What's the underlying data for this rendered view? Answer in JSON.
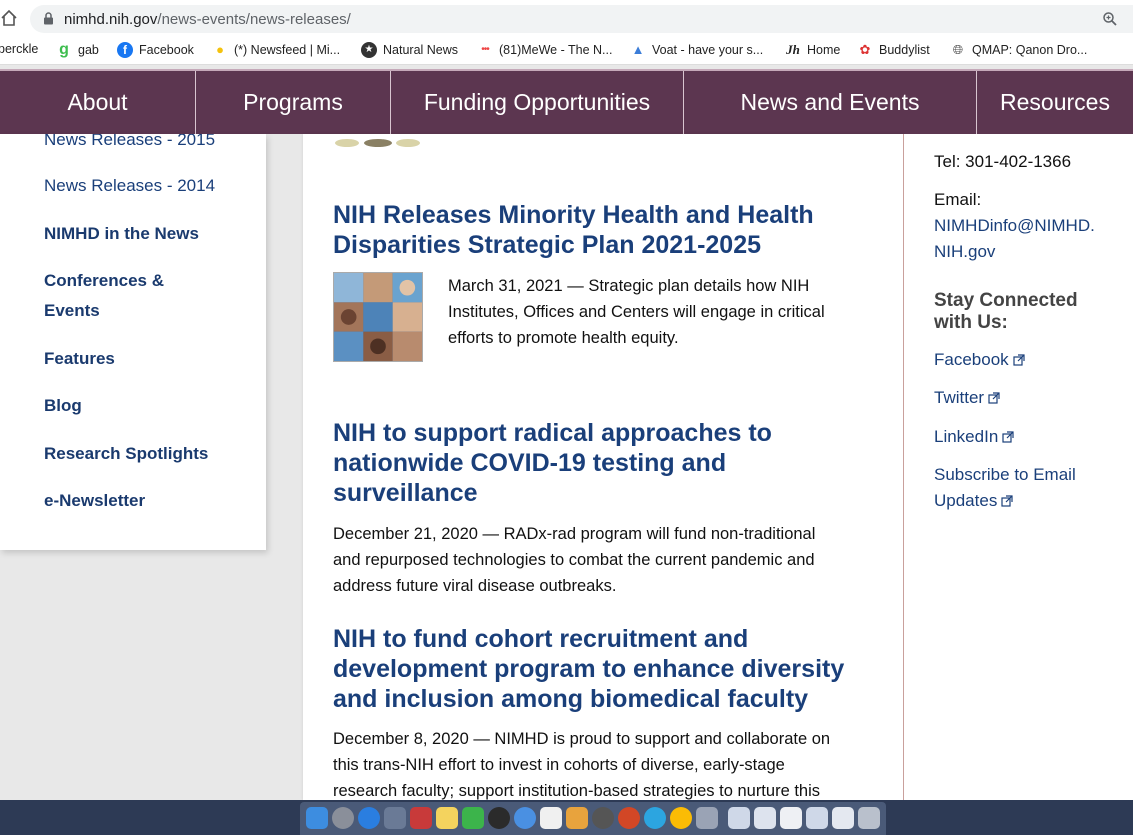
{
  "browser": {
    "url_domain": "nimhd.nih.gov",
    "url_path": "/news-events/news-releases/"
  },
  "bookmarks": [
    {
      "label": "perckle",
      "icon": "partial-bookmark"
    },
    {
      "label": "gab",
      "icon": "gab-icon"
    },
    {
      "label": "Facebook",
      "icon": "facebook-icon"
    },
    {
      "label": "(*) Newsfeed | Mi...",
      "icon": "lightbulb-icon"
    },
    {
      "label": "Natural News",
      "icon": "natural-news-icon"
    },
    {
      "label": "(81)MeWe - The N...",
      "icon": "mewe-icon"
    },
    {
      "label": "Voat - have your s...",
      "icon": "voat-icon"
    },
    {
      "label": "Home",
      "icon": "jh-icon"
    },
    {
      "label": "Buddylist",
      "icon": "buddylist-icon"
    },
    {
      "label": "QMAP: Qanon Dro...",
      "icon": "globe-icon"
    }
  ],
  "nav": {
    "items": [
      "About",
      "Programs",
      "Funding Opportunities",
      "News and Events",
      "Resources"
    ]
  },
  "sidebar": {
    "cut_item": "News Releases - 2015",
    "items": [
      {
        "label": "News Releases - 2014",
        "bold": false
      },
      {
        "label": "NIMHD in the News",
        "bold": true
      },
      {
        "label": "Conferences &",
        "label2": "Events",
        "bold": true
      },
      {
        "label": "Features",
        "bold": true
      },
      {
        "label": "Blog",
        "bold": true
      },
      {
        "label": "Research Spotlights",
        "bold": true
      },
      {
        "label": "e-Newsletter",
        "bold": true
      }
    ]
  },
  "articles": [
    {
      "title_line1": "NIH Releases Minority Health and Health",
      "title_line2": "Disparities Strategic Plan 2021-2025",
      "text_line1": "March 31, 2021 — Strategic plan details how NIH",
      "text_line2": "Institutes, Offices and Centers will engage in critical",
      "text_line3": "efforts to promote health equity."
    },
    {
      "title_line1": "NIH to support radical approaches to",
      "title_line2": "nationwide COVID-19 testing and",
      "title_line3": "surveillance",
      "text_line1": "December 21, 2020 — RADx-rad program will fund non-traditional",
      "text_line2": "and repurposed technologies to combat the current pandemic and",
      "text_line3": "address future viral disease outbreaks."
    },
    {
      "title_line1": "NIH to fund cohort recruitment and",
      "title_line2": "development program to enhance diversity",
      "title_line3": "and inclusion among biomedical faculty",
      "text_line1": "December 8, 2020 — NIMHD is proud to support and collaborate on",
      "text_line2": "this trans-NIH effort to invest in cohorts of diverse, early-stage",
      "text_line3": "research faculty; support institution-based strategies to nurture this"
    }
  ],
  "contact": {
    "tel": "Tel: 301-402-1366",
    "email_label": "Email:",
    "email_line1": "NIMHDinfo@NIMHD.",
    "email_line2": "NIH.gov",
    "stay_connected_line1": "Stay Connected",
    "stay_connected_line2": "with Us:",
    "links": [
      "Facebook",
      "Twitter",
      "LinkedIn"
    ],
    "subscribe_line1": "Subscribe to Email",
    "subscribe_line2": "Updates"
  },
  "colors": {
    "nav_bg": "#5c3650",
    "link": "#1a3f7a"
  }
}
